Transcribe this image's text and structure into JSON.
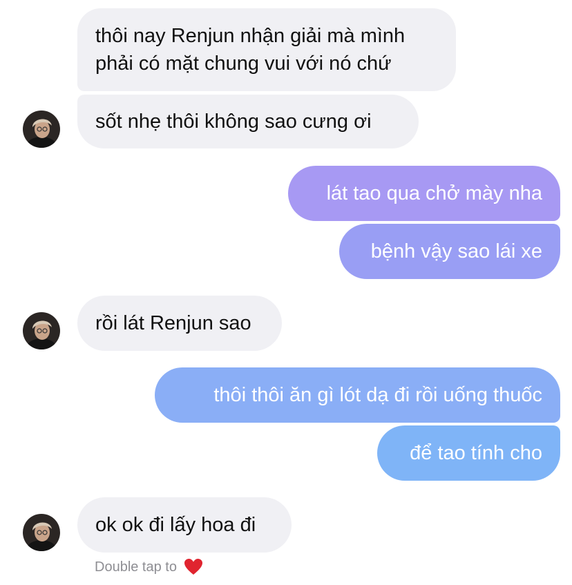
{
  "messages": [
    {
      "direction": "incoming",
      "lines": [
        "thôi nay Renjun nhận giải mà mình",
        "phải có mặt chung vui với nó chứ"
      ]
    },
    {
      "direction": "incoming",
      "text": "sốt nhẹ thôi không sao cưng ơi"
    },
    {
      "direction": "outgoing",
      "text": "lát tao qua chở mày nha"
    },
    {
      "direction": "outgoing",
      "text": "bệnh vậy sao lái xe"
    },
    {
      "direction": "incoming",
      "text": "rồi lát Renjun sao"
    },
    {
      "direction": "outgoing",
      "text": "thôi thôi ăn gì lót dạ đi rồi uống thuốc"
    },
    {
      "direction": "outgoing",
      "text": "để tao tính cho"
    },
    {
      "direction": "incoming",
      "text": "ok ok đi lấy hoa đi"
    }
  ],
  "footer": {
    "hint": "Double tap to",
    "icon": "heart-icon"
  },
  "colors": {
    "incoming_bubble": "#f0f0f4",
    "outgoing_purple": "#a799f3",
    "outgoing_blue": "#7fb4f7",
    "heart": "#e0242f"
  }
}
